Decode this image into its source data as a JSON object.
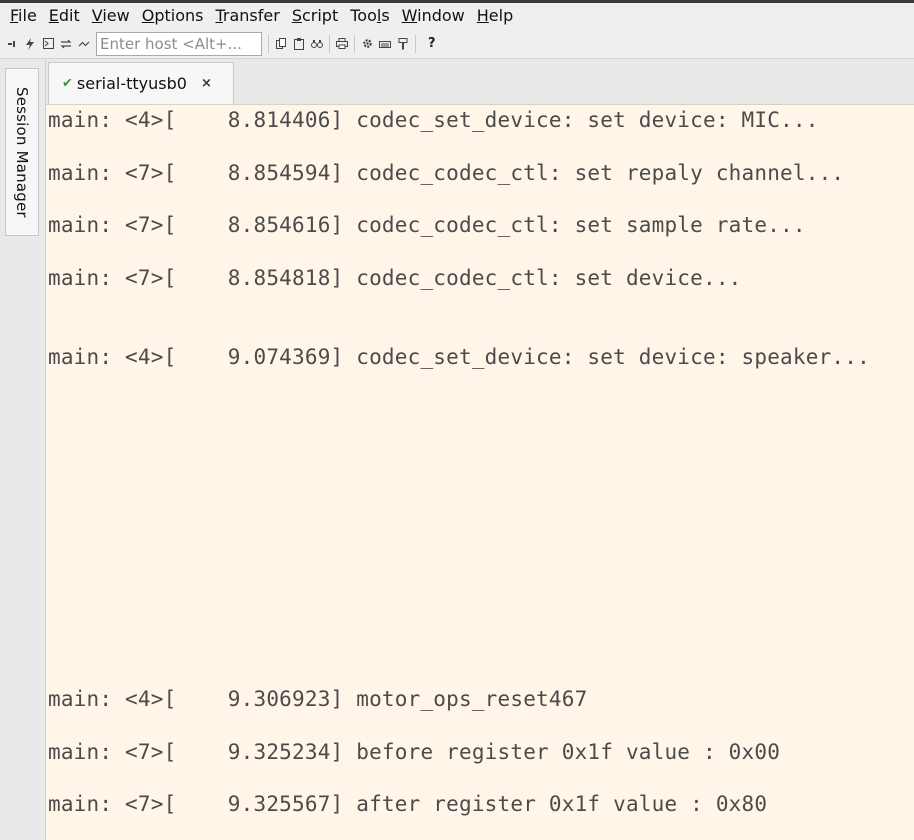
{
  "menubar": {
    "items": [
      {
        "label": "File",
        "mnemonic": "F",
        "rest": "ile"
      },
      {
        "label": "Edit",
        "mnemonic": "E",
        "rest": "dit"
      },
      {
        "label": "View",
        "mnemonic": "V",
        "rest": "iew"
      },
      {
        "label": "Options",
        "mnemonic": "O",
        "rest": "ptions"
      },
      {
        "label": "Transfer",
        "mnemonic": "T",
        "rest": "ransfer"
      },
      {
        "label": "Script",
        "mnemonic": "S",
        "rest": "cript"
      },
      {
        "label": "Tools",
        "pre": "Too",
        "mnemonic": "l",
        "rest": "s"
      },
      {
        "label": "Window",
        "mnemonic": "W",
        "rest": "indow"
      },
      {
        "label": "Help",
        "mnemonic": "H",
        "rest": "elp"
      }
    ]
  },
  "toolbar": {
    "host_placeholder": "Enter host <Alt+...",
    "help_label": "?",
    "icons": [
      "connect-icon",
      "quick-connect-icon",
      "connect-tab-icon",
      "reconnect-icon",
      "disconnect-icon",
      "copy-icon",
      "paste-icon",
      "find-icon",
      "print-icon",
      "settings-icon",
      "keymap-icon",
      "key-icon"
    ]
  },
  "dock": {
    "session_manager_label": "Session Manager"
  },
  "tabs": [
    {
      "label": "serial-ttyusb0",
      "status": "connected",
      "close_glyph": "×",
      "check_glyph": "✔"
    }
  ],
  "terminal": {
    "lines": [
      "main: <4>[    8.814406] codec_set_device: set device: MIC...",
      "main: <7>[    8.854594] codec_codec_ctl: set repaly channel...",
      "main: <7>[    8.854616] codec_codec_ctl: set sample rate...",
      "main: <7>[    8.854818] codec_codec_ctl: set device...",
      "main: <4>[    9.074369] codec_set_device: set device: speaker...",
      "main: <4>[    9.306923] motor_ops_reset467",
      "main: <7>[    9.325234] before register 0x1f value : 0x00",
      "main: <7>[    9.325567] after register 0x1f value : 0x80"
    ]
  },
  "colors": {
    "terminal_bg": "#fff6e9",
    "terminal_fg": "#4b4b4b",
    "connected_check": "#2f9e3a"
  }
}
